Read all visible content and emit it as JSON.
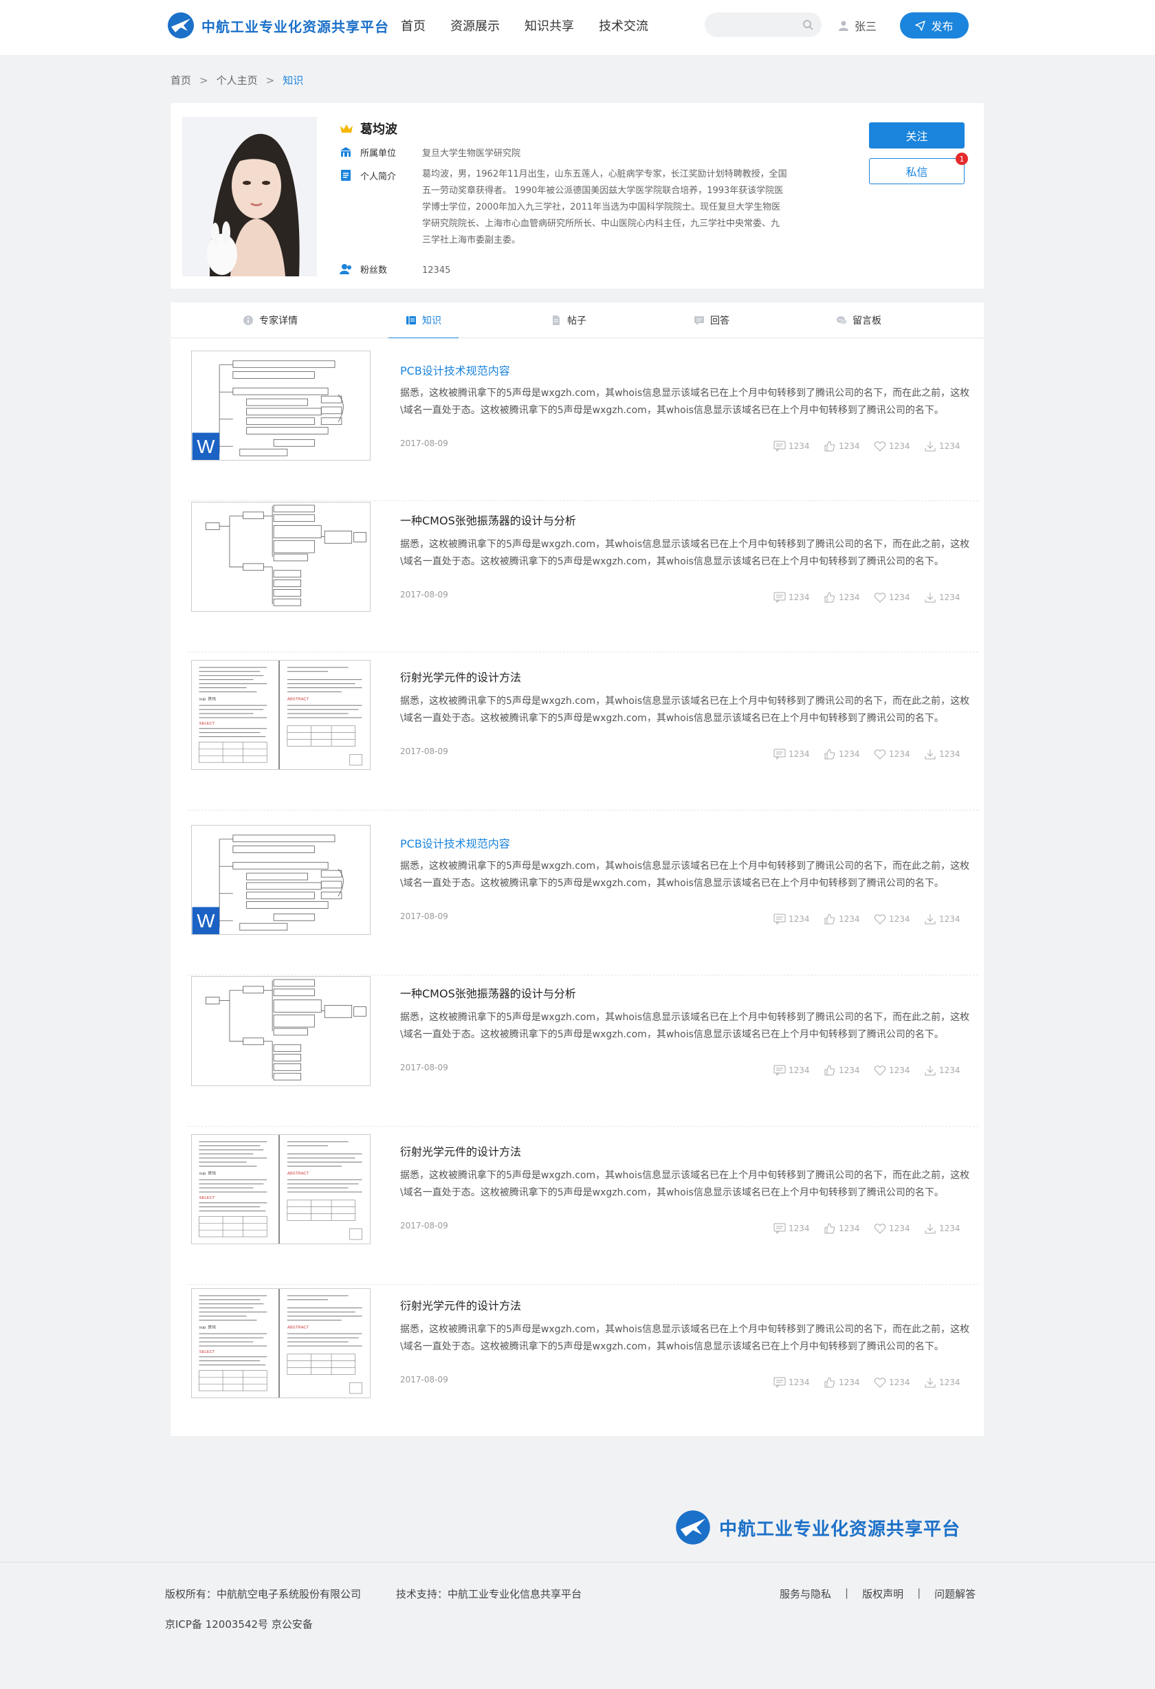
{
  "header": {
    "site_name": "中航工业专业化资源共享平台",
    "nav": [
      "首页",
      "资源展示",
      "知识共享",
      "技术交流"
    ],
    "search_placeholder": "",
    "user_name": "张三",
    "publish_label": "发布"
  },
  "breadcrumb": {
    "items": [
      "首页",
      "个人主页",
      "知识"
    ],
    "separator": ">"
  },
  "profile": {
    "name": "葛均波",
    "org_label": "所属单位",
    "org_value": "复旦大学生物医学研究院",
    "bio_label": "个人简介",
    "bio_value": "葛均波，男，1962年11月出生，山东五莲人，心脏病学专家，长江奖励计划特聘教授，全国五一劳动奖章获得者。 1990年被公派德国美因兹大学医学院联合培养，1993年获该学院医学博士学位，2000年加入九三学社，2011年当选为中国科学院院士。现任复旦大学生物医学研究院院长、上海市心血管病研究所所长、中山医院心内科主任，九三学社中央常委、九三学社上海市委副主委。",
    "fans_label": "粉丝数",
    "fans_value": "12345",
    "follow_label": "关注",
    "message_label": "私信",
    "message_badge": "1"
  },
  "tabs": [
    {
      "label": "专家详情",
      "icon": "info-icon"
    },
    {
      "label": "知识",
      "icon": "book-icon",
      "active": true
    },
    {
      "label": "帖子",
      "icon": "document-icon"
    },
    {
      "label": "回答",
      "icon": "answer-icon"
    },
    {
      "label": "留言板",
      "icon": "chat-icon"
    }
  ],
  "items": [
    {
      "title": "PCB设计技术规范内容",
      "title_highlighted": true,
      "thumb": "word-mindmap",
      "desc": "据悉，这枚被腾讯拿下的5声母是wxgzh.com，其whois信息显示该域名已在上个月中旬转移到了腾讯公司的名下，而在此之前，这枚\\域名一直处于态。这枚被腾讯拿下的5声母是wxgzh.com，其whois信息显示该域名已在上个月中旬转移到了腾讯公司的名下。",
      "date": "2017-08-09",
      "comments": "1234",
      "likes": "1234",
      "favorites": "1234",
      "downloads": "1234"
    },
    {
      "title": "一种CMOS张弛振荡器的设计与分析",
      "title_highlighted": false,
      "thumb": "mindmap",
      "desc": "据悉，这枚被腾讯拿下的5声母是wxgzh.com，其whois信息显示该域名已在上个月中旬转移到了腾讯公司的名下，而在此之前，这枚\\域名一直处于态。这枚被腾讯拿下的5声母是wxgzh.com，其whois信息显示该域名已在上个月中旬转移到了腾讯公司的名下。",
      "date": "2017-08-09",
      "comments": "1234",
      "likes": "1234",
      "favorites": "1234",
      "downloads": "1234"
    },
    {
      "title": "衍射光学元件的设计方法",
      "title_highlighted": false,
      "thumb": "paper",
      "desc": "据悉，这枚被腾讯拿下的5声母是wxgzh.com，其whois信息显示该域名已在上个月中旬转移到了腾讯公司的名下，而在此之前，这枚\\域名一直处于态。这枚被腾讯拿下的5声母是wxgzh.com，其whois信息显示该域名已在上个月中旬转移到了腾讯公司的名下。",
      "date": "2017-08-09",
      "comments": "1234",
      "likes": "1234",
      "favorites": "1234",
      "downloads": "1234"
    },
    {
      "title": "PCB设计技术规范内容",
      "title_highlighted": true,
      "thumb": "word-mindmap",
      "desc": "据悉，这枚被腾讯拿下的5声母是wxgzh.com，其whois信息显示该域名已在上个月中旬转移到了腾讯公司的名下，而在此之前，这枚\\域名一直处于态。这枚被腾讯拿下的5声母是wxgzh.com，其whois信息显示该域名已在上个月中旬转移到了腾讯公司的名下。",
      "date": "2017-08-09",
      "comments": "1234",
      "likes": "1234",
      "favorites": "1234",
      "downloads": "1234"
    },
    {
      "title": "一种CMOS张弛振荡器的设计与分析",
      "title_highlighted": false,
      "thumb": "mindmap",
      "desc": "据悉，这枚被腾讯拿下的5声母是wxgzh.com，其whois信息显示该域名已在上个月中旬转移到了腾讯公司的名下，而在此之前，这枚\\域名一直处于态。这枚被腾讯拿下的5声母是wxgzh.com，其whois信息显示该域名已在上个月中旬转移到了腾讯公司的名下。",
      "date": "2017-08-09",
      "comments": "1234",
      "likes": "1234",
      "favorites": "1234",
      "downloads": "1234"
    },
    {
      "title": "衍射光学元件的设计方法",
      "title_highlighted": false,
      "thumb": "paper",
      "desc": "据悉，这枚被腾讯拿下的5声母是wxgzh.com，其whois信息显示该域名已在上个月中旬转移到了腾讯公司的名下，而在此之前，这枚\\域名一直处于态。这枚被腾讯拿下的5声母是wxgzh.com，其whois信息显示该域名已在上个月中旬转移到了腾讯公司的名下。",
      "date": "2017-08-09",
      "comments": "1234",
      "likes": "1234",
      "favorites": "1234",
      "downloads": "1234"
    },
    {
      "title": "衍射光学元件的设计方法",
      "title_highlighted": false,
      "thumb": "paper",
      "desc": "据悉，这枚被腾讯拿下的5声母是wxgzh.com，其whois信息显示该域名已在上个月中旬转移到了腾讯公司的名下，而在此之前，这枚\\域名一直处于态。这枚被腾讯拿下的5声母是wxgzh.com，其whois信息显示该域名已在上个月中旬转移到了腾讯公司的名下。",
      "date": "2017-08-09",
      "comments": "1234",
      "likes": "1234",
      "favorites": "1234",
      "downloads": "1234"
    }
  ],
  "footer": {
    "site_name": "中航工业专业化资源共享平台",
    "copyright": "版权所有：中航航空电子系统股份有限公司",
    "tech_support": "技术支持：中航工业专业化信息共享平台",
    "icp": "京ICP备 12003542号 京公安备",
    "links": [
      "服务与隐私",
      "版权声明",
      "问题解答"
    ]
  },
  "colors": {
    "accent": "#1b84dc",
    "brand": "#1b70c8",
    "badge": "#e32b2b",
    "page_bg": "#f1f2f4"
  }
}
